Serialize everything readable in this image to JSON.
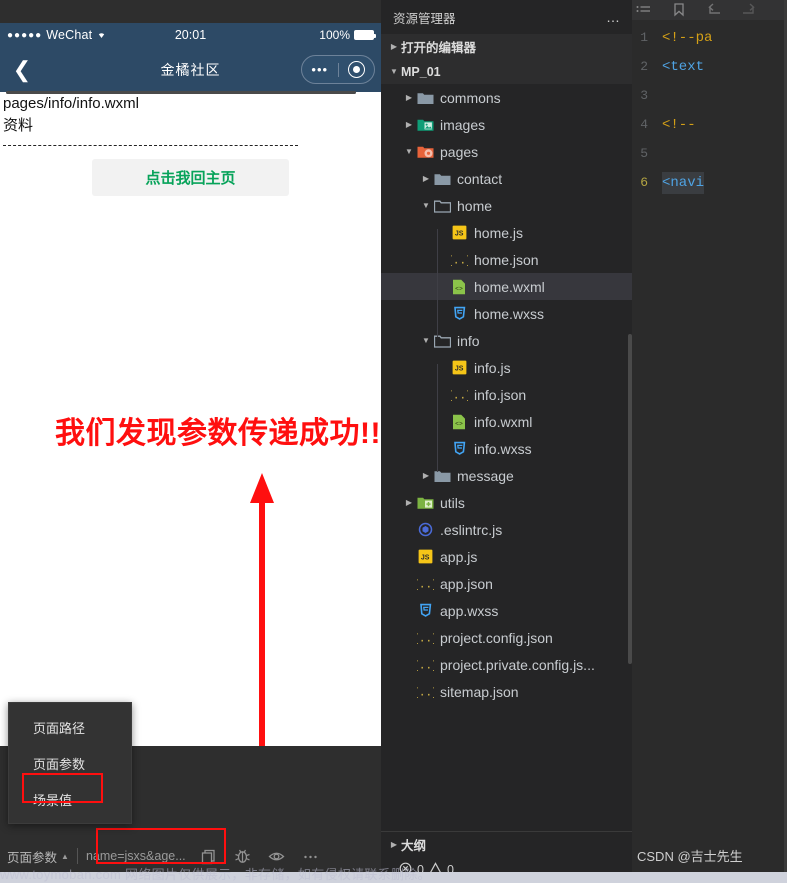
{
  "simulator": {
    "status_bar": {
      "carrier_dots": "●●●●●",
      "carrier": "WeChat",
      "wifi_icon": "wifi-icon",
      "time": "20:01",
      "battery_percent": "100%",
      "battery_icon": "battery-full-icon"
    },
    "nav_bar": {
      "back_icon": "chevron-left-icon",
      "title": "金橘社区",
      "more_icon": "more-horizontal-icon",
      "target_icon": "target-circle-icon"
    },
    "page": {
      "path_text": "pages/info/info.wxml",
      "label_text": "资料",
      "button_label": "点击我回主页"
    },
    "annotation": {
      "text": "我们发现参数传递成功!!!",
      "color": "#ff0f0f",
      "arrow_icon": "up-arrow-annotation"
    },
    "context_menu": {
      "items": [
        {
          "label": "页面路径",
          "highlighted": false
        },
        {
          "label": "页面参数",
          "highlighted": true
        },
        {
          "label": "场景值",
          "highlighted": false
        }
      ]
    },
    "status_footer": {
      "selector_label": "页面参数",
      "caret_icon": "caret-up-icon",
      "param_value": "name=jsxs&age...",
      "icons": [
        {
          "name": "copy-icon"
        },
        {
          "name": "bug-icon"
        },
        {
          "name": "eye-icon"
        },
        {
          "name": "more-horizontal-icon"
        }
      ]
    }
  },
  "explorer": {
    "title": "资源管理器",
    "more_icon": "more-horizontal-icon",
    "sections": [
      {
        "label": "打开的编辑器",
        "expanded": false
      },
      {
        "label": "MP_01",
        "expanded": true
      }
    ],
    "tree": [
      {
        "label": "commons",
        "depth": 1,
        "type": "folder",
        "arrow": "right",
        "selected": false
      },
      {
        "label": "images",
        "depth": 1,
        "type": "folder-img",
        "arrow": "right",
        "selected": false
      },
      {
        "label": "pages",
        "depth": 1,
        "type": "folder-page",
        "arrow": "down",
        "selected": false
      },
      {
        "label": "contact",
        "depth": 2,
        "type": "folder",
        "arrow": "right",
        "selected": false
      },
      {
        "label": "home",
        "depth": 2,
        "type": "folder-open",
        "arrow": "down",
        "selected": false
      },
      {
        "label": "home.js",
        "depth": 3,
        "type": "js",
        "arrow": "none",
        "selected": false
      },
      {
        "label": "home.json",
        "depth": 3,
        "type": "json",
        "arrow": "none",
        "selected": false
      },
      {
        "label": "home.wxml",
        "depth": 3,
        "type": "wxml",
        "arrow": "none",
        "selected": true
      },
      {
        "label": "home.wxss",
        "depth": 3,
        "type": "wxss",
        "arrow": "none",
        "selected": false
      },
      {
        "label": "info",
        "depth": 2,
        "type": "folder-open",
        "arrow": "down",
        "selected": false
      },
      {
        "label": "info.js",
        "depth": 3,
        "type": "js",
        "arrow": "none",
        "selected": false
      },
      {
        "label": "info.json",
        "depth": 3,
        "type": "json",
        "arrow": "none",
        "selected": false
      },
      {
        "label": "info.wxml",
        "depth": 3,
        "type": "wxml",
        "arrow": "none",
        "selected": false
      },
      {
        "label": "info.wxss",
        "depth": 3,
        "type": "wxss",
        "arrow": "none",
        "selected": false
      },
      {
        "label": "message",
        "depth": 2,
        "type": "folder",
        "arrow": "right",
        "selected": false
      },
      {
        "label": "utils",
        "depth": 1,
        "type": "folder-util",
        "arrow": "right",
        "selected": false
      },
      {
        "label": ".eslintrc.js",
        "depth": 1,
        "type": "eslint",
        "arrow": "none",
        "selected": false
      },
      {
        "label": "app.js",
        "depth": 1,
        "type": "js",
        "arrow": "none",
        "selected": false
      },
      {
        "label": "app.json",
        "depth": 1,
        "type": "json",
        "arrow": "none",
        "selected": false
      },
      {
        "label": "app.wxss",
        "depth": 1,
        "type": "wxss",
        "arrow": "none",
        "selected": false
      },
      {
        "label": "project.config.json",
        "depth": 1,
        "type": "json",
        "arrow": "none",
        "selected": false
      },
      {
        "label": "project.private.config.js...",
        "depth": 1,
        "type": "json",
        "arrow": "none",
        "selected": false
      },
      {
        "label": "sitemap.json",
        "depth": 1,
        "type": "json",
        "arrow": "none",
        "selected": false
      }
    ],
    "outline": {
      "label": "大纲",
      "expanded": false
    },
    "problems": {
      "error_icon": "error-circle-icon",
      "error_count": "0",
      "warning_icon": "warning-triangle-icon",
      "warning_count": "0"
    }
  },
  "editor": {
    "toolbar_icons": [
      {
        "name": "list-icon"
      },
      {
        "name": "bookmark-icon"
      },
      {
        "name": "arrow-back-icon"
      },
      {
        "name": "arrow-forward-icon"
      }
    ],
    "lines": [
      {
        "num": "1",
        "text": "<!--pa",
        "style": "comment",
        "selected": false
      },
      {
        "num": "2",
        "text": "<text",
        "style": "tag",
        "selected": false
      },
      {
        "num": "3",
        "text": "",
        "style": "plain",
        "selected": false
      },
      {
        "num": "4",
        "text": "<!-- ",
        "style": "comment",
        "selected": false
      },
      {
        "num": "5",
        "text": "",
        "style": "plain",
        "selected": false
      },
      {
        "num": "6",
        "text": "<navi",
        "style": "tag",
        "selected": true
      }
    ]
  },
  "watermarks": {
    "bottom_left": "www.toymoban.com 网络图片仅供展示，非存储，如有侵权请联系删除。",
    "bottom_right": "CSDN @吉士先生"
  }
}
